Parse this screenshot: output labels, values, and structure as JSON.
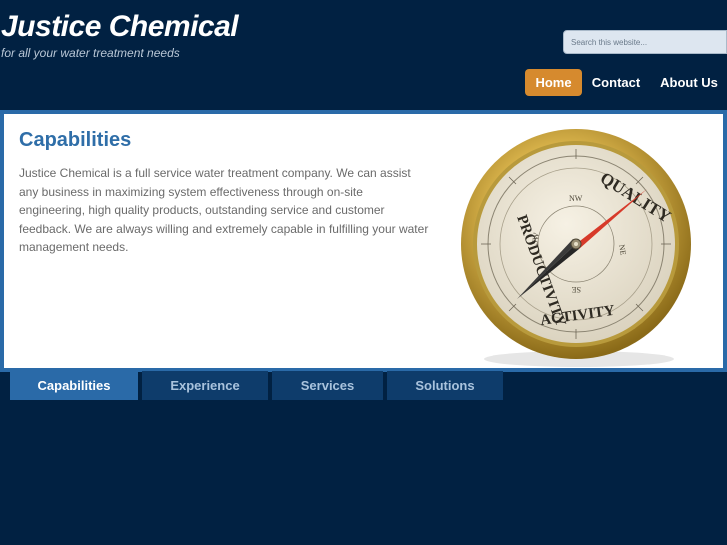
{
  "site": {
    "title": "Justice Chemical",
    "tagline": "for all your water treatment needs"
  },
  "search": {
    "placeholder": "Search this website..."
  },
  "nav": {
    "items": [
      {
        "label": "Home",
        "active": true
      },
      {
        "label": "Contact",
        "active": false
      },
      {
        "label": "About Us",
        "active": false
      }
    ]
  },
  "feature": {
    "title": "Capabilities",
    "body": "Justice Chemical is a full service water treatment company.  We can assist any business in maximizing system effectiveness through on-site engineering, high quality products, outstanding service and customer feedback.  We are always willing and extremely capable in fulfilling your water management needs.",
    "image": {
      "word_top": "QUALITY",
      "word_left": "PRODUCTIVITY",
      "word_bottom": "ACTIVITY",
      "dir_nw": "NW",
      "dir_ne": "NE",
      "dir_sw": "SW",
      "dir_se": "SE"
    }
  },
  "tabs": [
    {
      "label": "Capabilities",
      "active": true
    },
    {
      "label": "Experience",
      "active": false
    },
    {
      "label": "Services",
      "active": false
    },
    {
      "label": "Solutions",
      "active": false
    }
  ],
  "colors": {
    "background": "#012142",
    "accent": "#d68a2e",
    "panel_border": "#2a6aa8",
    "heading": "#2f6ea8"
  }
}
